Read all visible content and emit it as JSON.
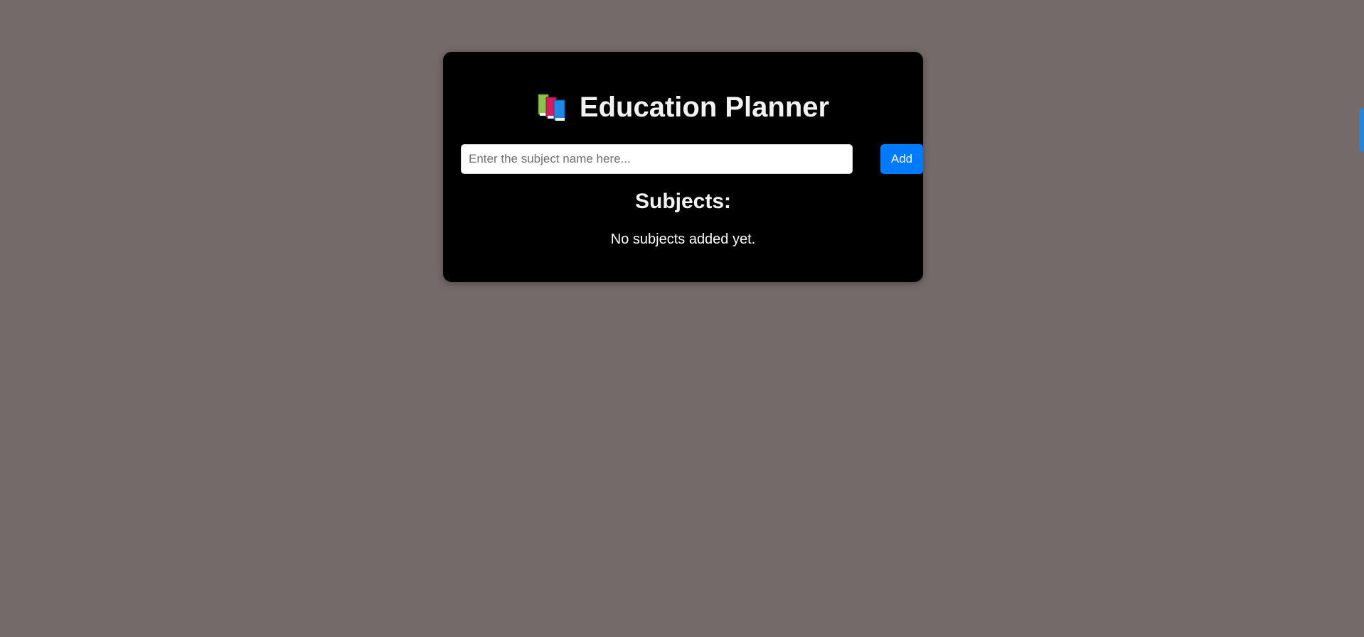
{
  "planner": {
    "title": "Education Planner",
    "title_icon": "books-icon",
    "subject_input": {
      "placeholder": "Enter the subject name here...",
      "value": ""
    },
    "add_label": "Add",
    "subjects_heading": "Subjects:",
    "empty_message": "No subjects added yet."
  },
  "colors": {
    "background": "#746a69",
    "card": "#000000",
    "accent": "#007bff",
    "text": "#f2f2f2"
  }
}
